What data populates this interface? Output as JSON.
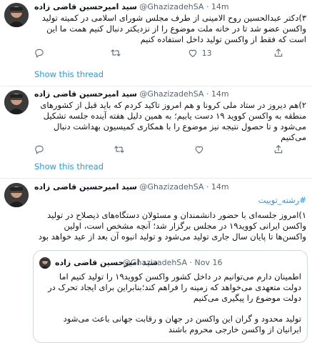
{
  "tweets": [
    {
      "name": "سید امیرحسین قاضی زاده",
      "handle": "@GhazizadehSA",
      "time": "· 14m",
      "text": "۳)دکتر عبدالحسین روح الامینی از طرف مجلس شورای اسلامی در کمیته تولید واکسن عضو شد تا در خانه ملت موضوع را از نزدیکتر دنبال کنیم همت ما این است که فقط از واکسن تولید داخل استفاده کنیم",
      "reply_count": "",
      "retweet_count": "",
      "like_count": "13",
      "show_thread": "Show this thread"
    },
    {
      "name": "سید امیرحسین قاضی زاده",
      "handle": "@GhazizadehSA",
      "time": "· 14m",
      "text": "۲)هم دیروز در ستاد ملی کرونا و هم امروز تاکید کردم که باید قبل از کشورهای منطقه به واکسن کووید ۱۹ دست یابیم؛ به همین دلیل هفته آینده جلسه تشکیل می‌شود و تا حصول نتیجه نیز موضوع را با همکاری کمیسیون بهداشت دنبال می‌کنیم",
      "reply_count": "",
      "retweet_count": "",
      "like_count": "",
      "show_thread": "Show this thread"
    },
    {
      "name": "سید امیرحسین قاضی زاده",
      "handle": "@GhazizadehSA",
      "time": "· 14m",
      "hashtag": "#رشته_توییت",
      "text": "۱)امروز جلسه‌ای با حضور دانشمندان و مسئولان دستگاه‌های ذیصلاح در تولید واکسن ایرانی کووید۱۹ در مجلس برگزار شد؛ آنچه مشخص است، اولین واکسن‌ها تا پایان سال جاری تولید می‌شود و تولید انبوه آن بعد از عید خواهد بود",
      "quote": {
        "name": "سید امیرحسین قاضی زاده",
        "handle": "@GhazizadehSA",
        "time": "· Nov 16",
        "text1": "اطمینان دارم می‌توانیم در داخل کشور واکسن کووید۱۹ را تولید کنیم اما دولت متعهدی می‌خواهد که زمینه را فراهم کند؛بنابراین برای ایجاد تحرک در دولت موضوع را پیگیری می‌کنیم",
        "text2": "تولید محدود و گران این واکسن در جهان و رقابت جهانی باعث می‌شود ایرانیان از واکسن خارجی محروم باشند"
      }
    }
  ]
}
